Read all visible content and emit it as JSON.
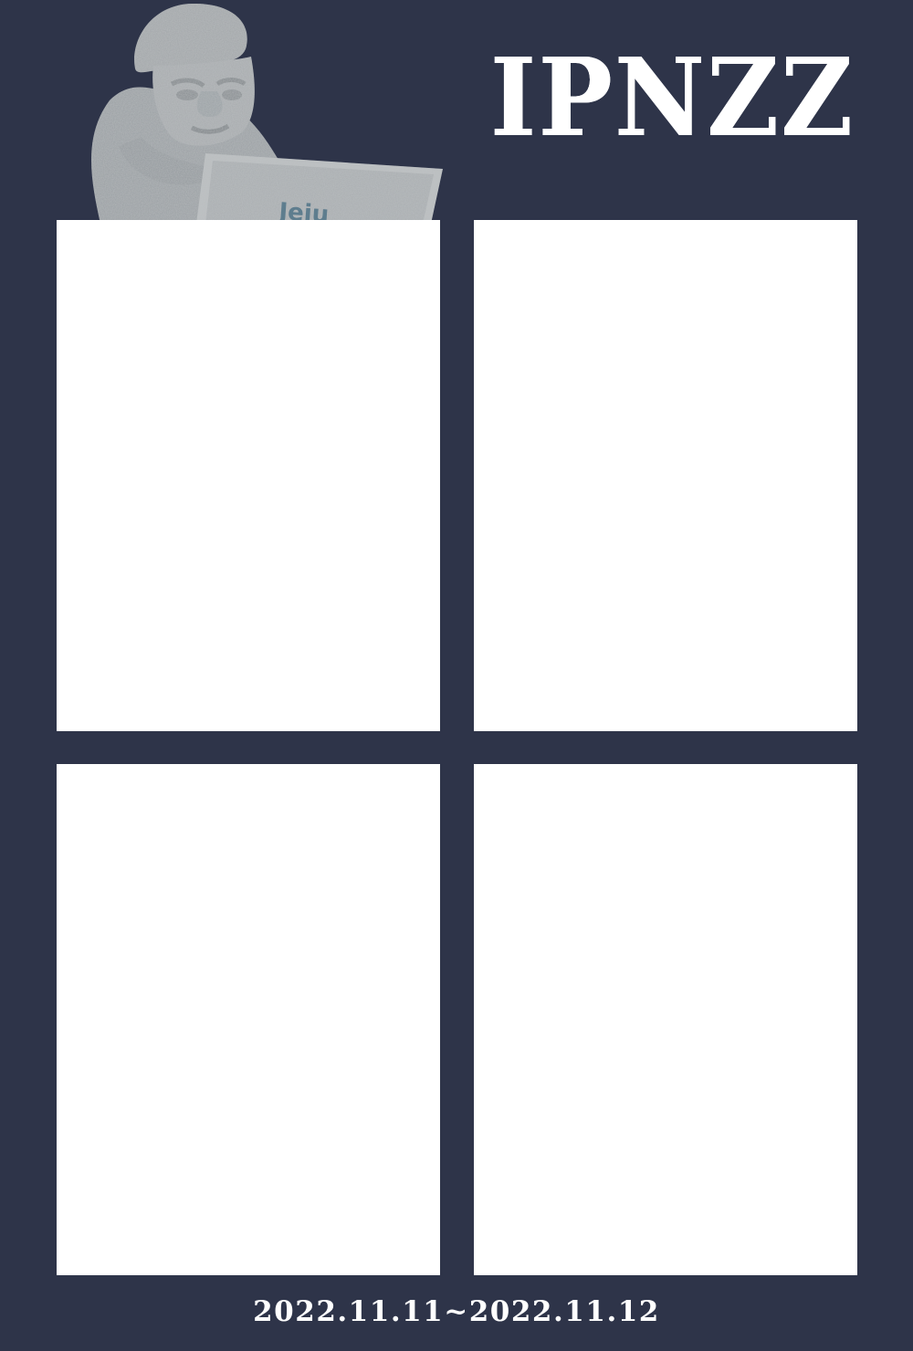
{
  "brand": {
    "title": "IPNZZ",
    "date_range": "2022.11.11~2022.11.12"
  },
  "statue_sign_text": "Jeju",
  "photo_slots": [
    {
      "id": "slot-1"
    },
    {
      "id": "slot-2"
    },
    {
      "id": "slot-3"
    },
    {
      "id": "slot-4"
    }
  ],
  "colors": {
    "background": "#2e3449",
    "slot": "#ffffff",
    "text": "#ffffff"
  },
  "icons": {
    "statue": "dol-hareubang-statue-icon"
  }
}
